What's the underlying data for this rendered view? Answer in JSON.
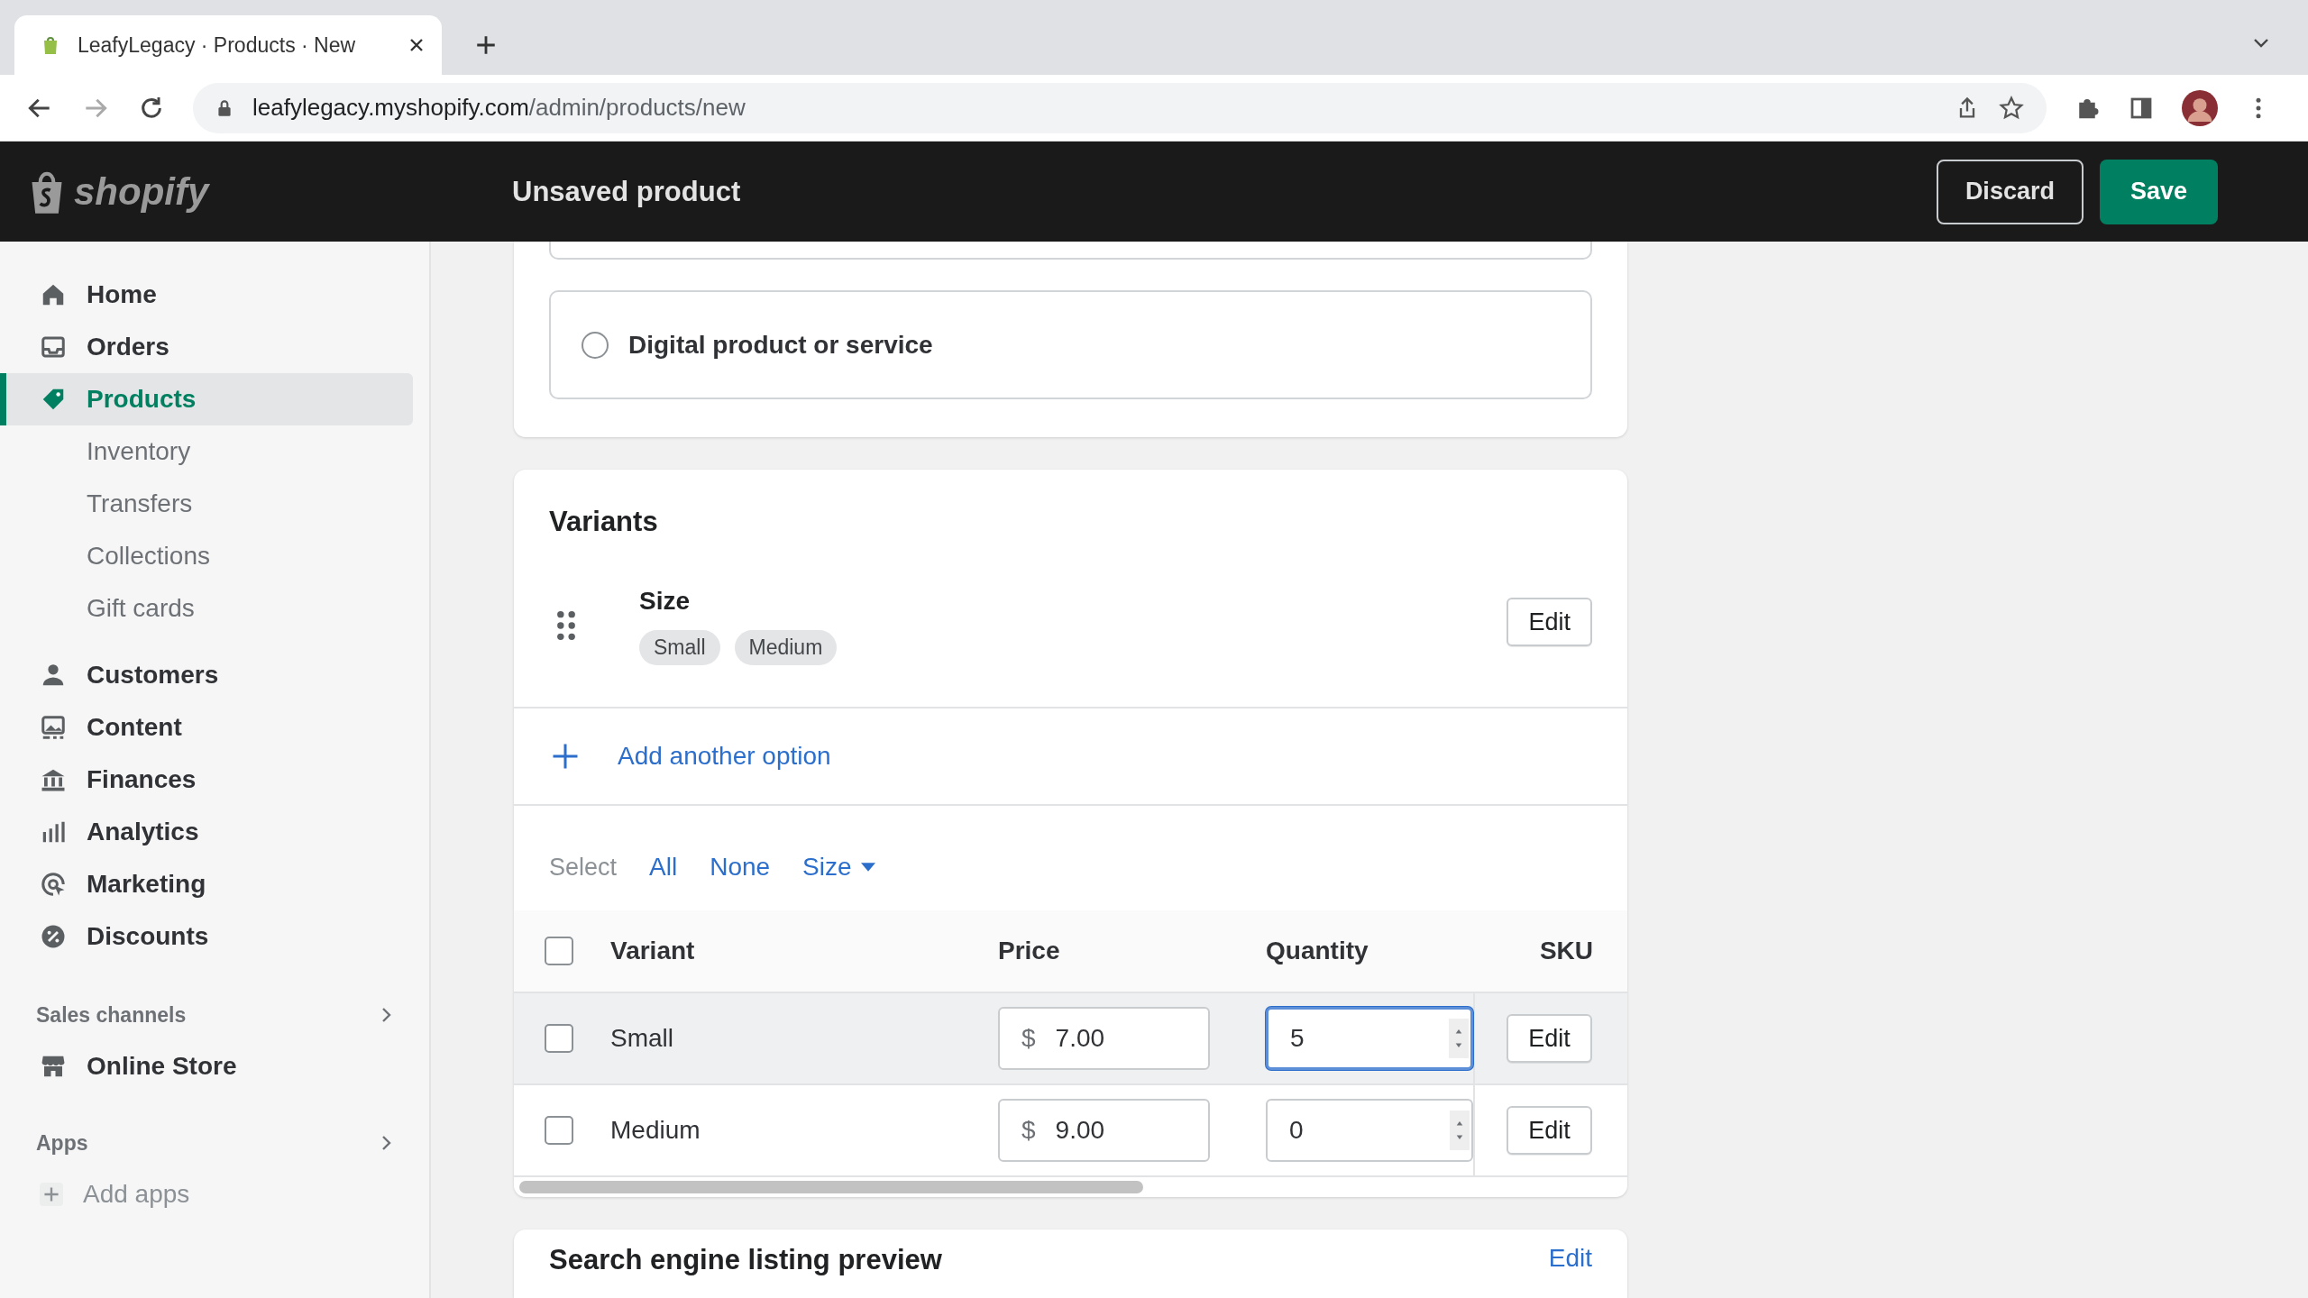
{
  "browser": {
    "tab": {
      "title": "LeafyLegacy · Products · New"
    },
    "url_host": "leafylegacy.myshopify.com",
    "url_path": "/admin/products/new"
  },
  "topbar": {
    "logo": "shopify",
    "title": "Unsaved product",
    "buttons": [
      {
        "label": "Discard",
        "kind": "secondary"
      },
      {
        "label": "Save",
        "kind": "primary"
      }
    ]
  },
  "sidebar": {
    "groups": [
      {
        "items": [
          {
            "label": "Home",
            "selected": false
          },
          {
            "label": "Orders",
            "selected": false
          },
          {
            "label": "Products",
            "selected": true,
            "children": [
              {
                "label": "Inventory",
                "selected": false
              },
              {
                "label": "Transfers",
                "selected": false
              },
              {
                "label": "Collections",
                "selected": false
              },
              {
                "label": "Gift cards",
                "selected": false
              }
            ]
          }
        ]
      },
      {
        "items": [
          {
            "label": "Customers",
            "selected": false
          },
          {
            "label": "Content",
            "selected": false
          },
          {
            "label": "Finances",
            "selected": false
          },
          {
            "label": "Analytics",
            "selected": false
          },
          {
            "label": "Marketing",
            "selected": false
          },
          {
            "label": "Discounts",
            "selected": false
          }
        ]
      }
    ],
    "sections": [
      {
        "title": "Sales channels",
        "items": [
          {
            "label": "Online Store",
            "kind": "channel"
          }
        ]
      },
      {
        "title": "Apps",
        "items": [
          {
            "label": "Add apps",
            "kind": "add"
          }
        ]
      }
    ]
  },
  "product_type": {
    "option": {
      "label": "Digital product or service",
      "selected": false
    }
  },
  "variants": {
    "title": "Variants",
    "option": {
      "name": "Size",
      "values": [
        "Small",
        "Medium"
      ],
      "edit": "Edit"
    },
    "add_option": "Add another option",
    "select": {
      "label": "Select",
      "links": [
        {
          "label": "All",
          "kind": "link"
        },
        {
          "label": "None",
          "kind": "link"
        },
        {
          "label": "Size",
          "kind": "dropdown"
        }
      ]
    },
    "table": {
      "columns": [
        "Variant",
        "Price",
        "Quantity",
        "SKU"
      ],
      "all_checked": false,
      "rows": [
        {
          "name": "Small",
          "checked": false,
          "highlighted": true,
          "currency": "$",
          "price": "7.00",
          "quantity": "5",
          "focused": true,
          "edit": "Edit"
        },
        {
          "name": "Medium",
          "checked": false,
          "highlighted": false,
          "currency": "$",
          "price": "9.00",
          "quantity": "0",
          "focused": false,
          "edit": "Edit"
        }
      ]
    }
  },
  "seo": {
    "title": "Search engine listing preview",
    "edit": "Edit"
  }
}
